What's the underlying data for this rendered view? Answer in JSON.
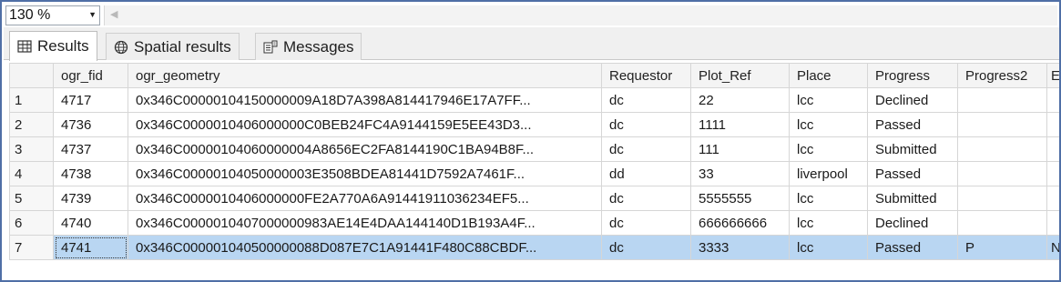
{
  "zoom": {
    "value": "130 %"
  },
  "tabs": [
    {
      "label": "Results",
      "icon": "grid-icon",
      "active": true
    },
    {
      "label": "Spatial results",
      "icon": "globe-icon",
      "active": false
    },
    {
      "label": "Messages",
      "icon": "messages-icon",
      "active": false
    }
  ],
  "grid": {
    "columns": [
      "ogr_fid",
      "ogr_geometry",
      "Requestor",
      "Plot_Ref",
      "Place",
      "Progress",
      "Progress2",
      "E"
    ],
    "rows": [
      {
        "num": "1",
        "cells": [
          "4717",
          "0x346C00000104150000009A18D7A398A814417946E17A7FF...",
          "dc",
          "22",
          "lcc",
          "Declined",
          "",
          ""
        ]
      },
      {
        "num": "2",
        "cells": [
          "4736",
          "0x346C0000010406000000C0BEB24FC4A9144159E5EE43D3...",
          "dc",
          "1111",
          "lcc",
          "Passed",
          "",
          ""
        ]
      },
      {
        "num": "3",
        "cells": [
          "4737",
          "0x346C00000104060000004A8656EC2FA8144190C1BA94B8F...",
          "dc",
          "111",
          "lcc",
          "Submitted",
          "",
          ""
        ]
      },
      {
        "num": "4",
        "cells": [
          "4738",
          "0x346C00000104050000003E3508BDEA81441D7592A7461F...",
          "dd",
          "33",
          "liverpool",
          "Passed",
          "",
          ""
        ]
      },
      {
        "num": "5",
        "cells": [
          "4739",
          "0x346C0000010406000000FE2A770A6A91441911036234EF5...",
          "dc",
          "5555555",
          "lcc",
          "Submitted",
          "",
          ""
        ]
      },
      {
        "num": "6",
        "cells": [
          "4740",
          "0x346C0000010407000000983AE14E4DAA144140D1B193A4F...",
          "dc",
          "666666666",
          "lcc",
          "Declined",
          "",
          ""
        ]
      },
      {
        "num": "7",
        "cells": [
          "4741",
          "0x346C000001040500000088D087E7C1A91441F480C88CBDF...",
          "dc",
          "3333",
          "lcc",
          "Passed",
          "P",
          "N"
        ],
        "selected": true
      }
    ]
  }
}
